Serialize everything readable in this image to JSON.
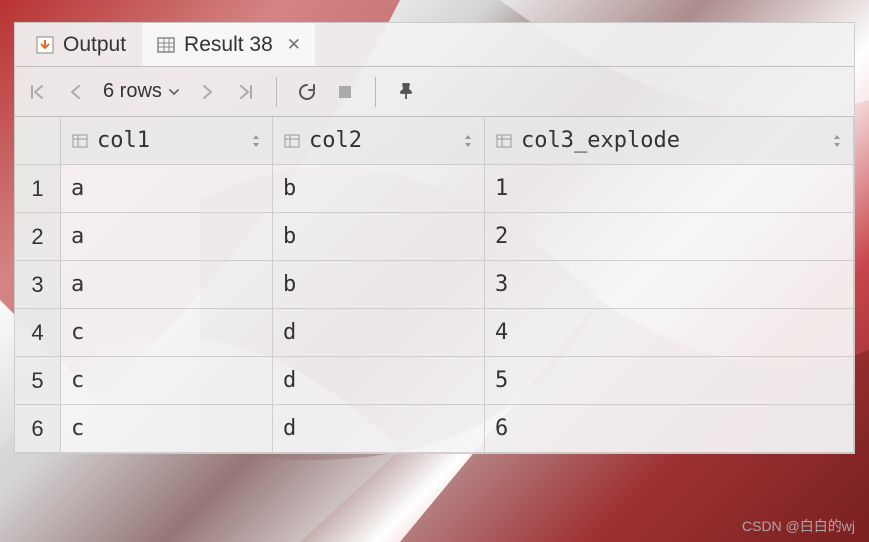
{
  "tabs": {
    "output": "Output",
    "result": "Result 38"
  },
  "toolbar": {
    "rows_label": "6 rows"
  },
  "columns": [
    "col1",
    "col2",
    "col3_explode"
  ],
  "rows": [
    {
      "n": "1",
      "c0": "a",
      "c1": "b",
      "c2": "1"
    },
    {
      "n": "2",
      "c0": "a",
      "c1": "b",
      "c2": "2"
    },
    {
      "n": "3",
      "c0": "a",
      "c1": "b",
      "c2": "3"
    },
    {
      "n": "4",
      "c0": "c",
      "c1": "d",
      "c2": "4"
    },
    {
      "n": "5",
      "c0": "c",
      "c1": "d",
      "c2": "5"
    },
    {
      "n": "6",
      "c0": "c",
      "c1": "d",
      "c2": "6"
    }
  ],
  "watermark": "CSDN @白白的wj"
}
